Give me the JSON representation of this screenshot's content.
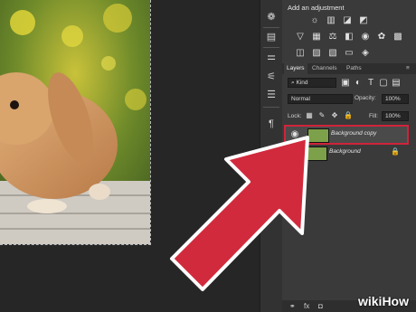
{
  "adjustments": {
    "title": "Add an adjustment",
    "row1_icons": [
      "brightness-icon",
      "levels-icon",
      "curves-icon",
      "exposure-icon"
    ],
    "row2_icons": [
      "vibrance-icon",
      "hue-saturation-icon",
      "color-balance-icon",
      "black-white-icon",
      "photo-filter-icon",
      "channel-mixer-icon",
      "color-lookup-icon"
    ],
    "row3_icons": [
      "invert-icon",
      "posterize-icon",
      "threshold-icon",
      "gradient-map-icon",
      "selective-color-icon"
    ]
  },
  "layers_panel": {
    "tabs": [
      "Layers",
      "Channels",
      "Paths"
    ],
    "filter_kind": "Kind",
    "blend_mode": "Normal",
    "opacity_label": "Opacity:",
    "opacity_value": "100%",
    "lock_label": "Lock:",
    "fill_label": "Fill:",
    "fill_value": "100%",
    "layers": [
      {
        "name": "Background copy",
        "selected": true
      },
      {
        "name": "Background",
        "selected": false,
        "locked": true
      }
    ]
  },
  "watermark": "wikiHow",
  "colors": {
    "highlight": "#d0243a",
    "arrow": "#d12a3c",
    "panel_bg": "#3a3a3a"
  }
}
